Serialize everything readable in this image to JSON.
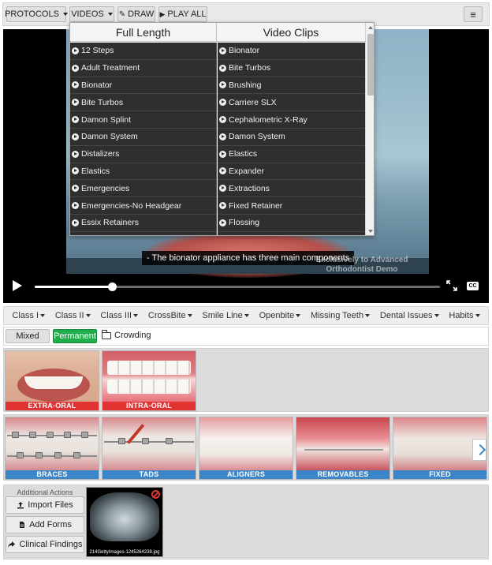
{
  "toolbar": {
    "protocols_label": "PROTOCOLS",
    "videos_label": "VIDEOS",
    "draw_label": "DRAW",
    "play_all_label": "PLAY ALL"
  },
  "video": {
    "caption": "- The bionator appliance has three main components",
    "watermark": "Exclusively to Advanced Orthodontist Demo",
    "progress": 0.19
  },
  "dropdown": {
    "full_length_header": "Full Length",
    "video_clips_header": "Video Clips",
    "full_length": [
      "12 Steps",
      "Adult Treatment",
      "Bionator",
      "Bite Turbos",
      "Damon Splint",
      "Damon System",
      "Distalizers",
      "Elastics",
      "Emergencies",
      "Emergencies-No Headgear",
      "Essix Retainers"
    ],
    "video_clips": [
      "Bionator",
      "Bite Turbos",
      "Brushing",
      "Carriere SLX",
      "Cephalometric X-Ray",
      "Damon System",
      "Elastics",
      "Expander",
      "Extractions",
      "Fixed Retainer",
      "Flossing"
    ]
  },
  "classbar": [
    "Class I",
    "Class II",
    "Class III",
    "CrossBite",
    "Smile Line",
    "Openbite",
    "Missing Teeth",
    "Dental Issues",
    "Habits"
  ],
  "filters": {
    "mixed_label": "Mixed",
    "permanent_label": "Permanent",
    "crowding_label": "Crowding"
  },
  "exam_thumbs": [
    "EXTRA-ORAL",
    "INTRA-ORAL"
  ],
  "treatment_thumbs": [
    "BRACES",
    "TADS",
    "ALIGNERS",
    "REMOVABLES",
    "FIXED"
  ],
  "actions": {
    "title": "Additional Actions",
    "import_label": "Import Files",
    "forms_label": "Add Forms",
    "findings_label": "Clinical Findings",
    "xray_filename": "214GettyImages-1245264238.jpg"
  },
  "colors": {
    "label_red": "#e03332",
    "label_blue": "#3a86c8",
    "permanent_green": "#1fae4b"
  }
}
